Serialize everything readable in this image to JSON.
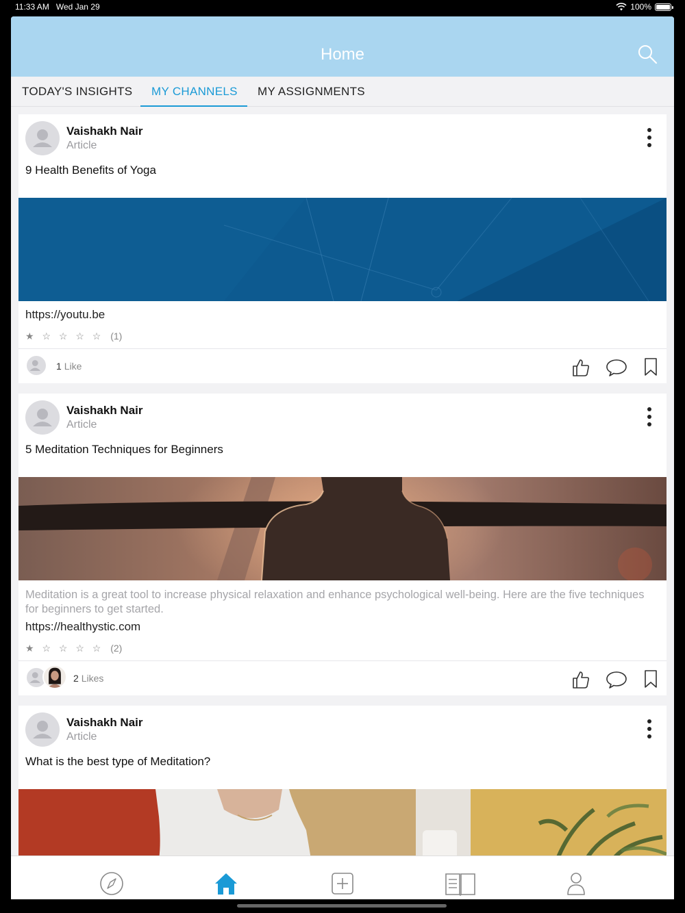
{
  "status_bar": {
    "time": "11:33 AM",
    "date": "Wed Jan 29",
    "battery": "100%"
  },
  "header": {
    "title": "Home",
    "search_icon": "search-icon"
  },
  "tabs": [
    {
      "label": "TODAY'S INSIGHTS",
      "active": false
    },
    {
      "label": "MY CHANNELS",
      "active": true
    },
    {
      "label": "MY ASSIGNMENTS",
      "active": false
    }
  ],
  "colors": {
    "header_bg": "#aad6f0",
    "accent": "#1a9ad6"
  },
  "posts": [
    {
      "author": "Vaishakh Nair",
      "type": "Article",
      "title": "9 Health Benefits of Yoga",
      "description": "",
      "link": "https://youtu.be",
      "stars": "★ ☆ ☆ ☆ ☆",
      "rating_count": "(1)",
      "likes_count": "1",
      "likes_label": "Like"
    },
    {
      "author": "Vaishakh Nair",
      "type": "Article",
      "title": "5 Meditation Techniques for Beginners",
      "description": "Meditation is a great tool to increase physical relaxation and enhance psychological well-being. Here are the five techniques for beginners to get started.",
      "link": "https://healthystic.com",
      "stars": "★ ☆ ☆ ☆ ☆",
      "rating_count": "(2)",
      "likes_count": "2",
      "likes_label": "Likes"
    },
    {
      "author": "Vaishakh Nair",
      "type": "Article",
      "title": "What is the best type of Meditation?"
    }
  ],
  "bottom_nav": [
    {
      "icon": "compass-icon",
      "active": false
    },
    {
      "icon": "home-icon",
      "active": true
    },
    {
      "icon": "add-icon",
      "active": false
    },
    {
      "icon": "book-icon",
      "active": false
    },
    {
      "icon": "profile-icon",
      "active": false
    }
  ]
}
